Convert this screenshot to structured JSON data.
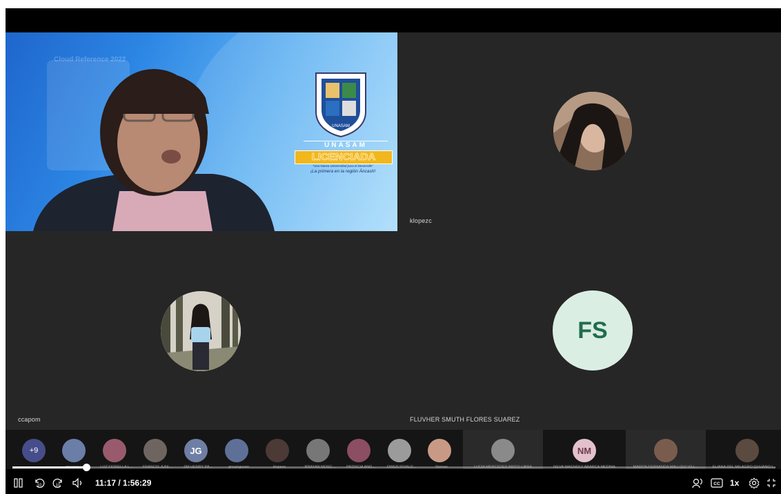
{
  "tiles": {
    "presenter": {
      "name": "",
      "banner": {
        "university": "UNASAM",
        "badge": "LICENCIADA",
        "slogan": "\"Una Nueva Universidad para el Desarrollo\"",
        "tagline": "¡La primera en la región Áncash!",
        "seal_text": "UNASAM",
        "faded_text": "Cloud Reference 2022"
      }
    },
    "klopezc": {
      "name": "klopezc"
    },
    "ccapom": {
      "name": "ccapom"
    },
    "flores": {
      "name": "FLUVHER SMUTH FLORES SUAREZ",
      "initials": "FS"
    }
  },
  "strip": {
    "more": "+9",
    "participants": [
      {
        "name": "gnsangucen",
        "initials": "",
        "color": "#6b7ea8"
      },
      {
        "name": "LUZ FIORELLA L...",
        "initials": "",
        "color": "#9a5a6d"
      },
      {
        "name": "FRANCIS JUNI...",
        "initials": "",
        "color": "#6f6560"
      },
      {
        "name": "JIM HENRY PA...",
        "initials": "JG",
        "color": "#6f7ea4"
      },
      {
        "name": "gnsangucen",
        "initials": "",
        "color": "#5f7098"
      },
      {
        "name": "klopezc",
        "initials": "",
        "color": "#4c3a36"
      },
      {
        "name": "BRAYAN MOSC...",
        "initials": "",
        "color": "#777"
      },
      {
        "name": "PATRICIA AND...",
        "initials": "",
        "color": "#8c4e62"
      },
      {
        "name": "OWEN RIVALD...",
        "initials": "",
        "color": "#9b9b9b"
      },
      {
        "name": "Nomos",
        "initials": "",
        "color": "#c89a86"
      },
      {
        "name": "LUCIA MERCEDES BRITO LIBRA",
        "initials": "",
        "color": "#8a8a8a"
      },
      {
        "name": "NILVA MAGNOLY ABARCA MEDINA",
        "initials": "NM",
        "color": "#e3c1cc"
      },
      {
        "name": "MARITA FERNANDA MALLQUI VILL...",
        "initials": "",
        "color": "#7a5c4e"
      },
      {
        "name": "ELIANA DEL MILAGRO QUIJANO I...",
        "initials": "",
        "color": "#5b4a40"
      }
    ]
  },
  "controls": {
    "time": "11:17 / 1:56:29",
    "speed": "1x",
    "progress": 0.0964
  },
  "colors": {
    "tile_bg": "#262626",
    "initials_bg": "#dbeee4",
    "initials_fg": "#1f6e4b",
    "more_bg": "#464d8a",
    "jg_bg": "#6f7ea4",
    "nm_bg": "#e3c1cc",
    "gold": "#f2b71a"
  }
}
